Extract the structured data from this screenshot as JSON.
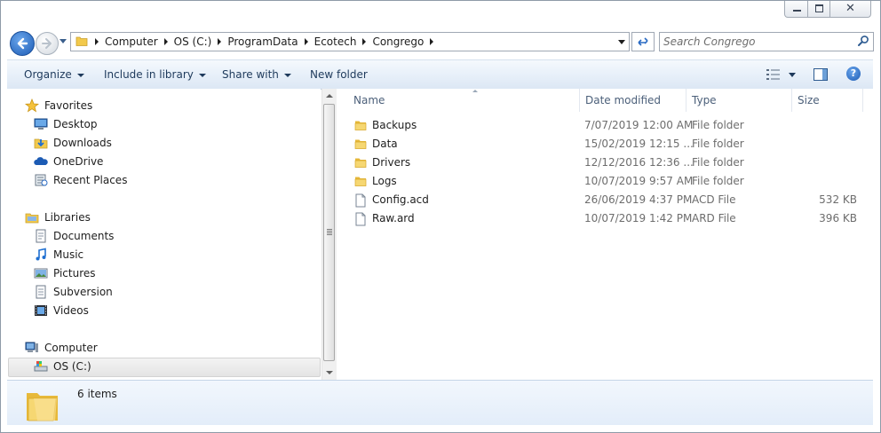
{
  "window": {
    "caption_buttons": {
      "minimize": "minimize",
      "maximize": "maximize",
      "close": "✕"
    }
  },
  "address_bar": {
    "crumbs": [
      "Computer",
      "OS (C:)",
      "ProgramData",
      "Ecotech",
      "Congrego"
    ]
  },
  "search": {
    "placeholder": "Search Congrego"
  },
  "toolbar": {
    "organize": "Organize",
    "include_in_library": "Include in library",
    "share_with": "Share with",
    "new_folder": "New folder",
    "help": "?"
  },
  "nav": {
    "favorites": {
      "label": "Favorites",
      "items": [
        {
          "label": "Desktop",
          "icon": "desktop-icon"
        },
        {
          "label": "Downloads",
          "icon": "downloads-icon"
        },
        {
          "label": "OneDrive",
          "icon": "onedrive-icon"
        },
        {
          "label": "Recent Places",
          "icon": "recent-places-icon"
        }
      ]
    },
    "libraries": {
      "label": "Libraries",
      "items": [
        {
          "label": "Documents",
          "icon": "documents-icon"
        },
        {
          "label": "Music",
          "icon": "music-icon"
        },
        {
          "label": "Pictures",
          "icon": "pictures-icon"
        },
        {
          "label": "Subversion",
          "icon": "subversion-icon"
        },
        {
          "label": "Videos",
          "icon": "videos-icon"
        }
      ]
    },
    "computer": {
      "label": "Computer",
      "items": [
        {
          "label": "OS (C:)",
          "icon": "drive-icon",
          "selected": true
        }
      ]
    }
  },
  "file_list": {
    "columns": [
      "Name",
      "Date modified",
      "Type",
      "Size"
    ],
    "rows": [
      {
        "name": "Backups",
        "date": "7/07/2019 12:00 AM",
        "type": "File folder",
        "size": "",
        "kind": "folder"
      },
      {
        "name": "Data",
        "date": "15/02/2019 12:15 ...",
        "type": "File folder",
        "size": "",
        "kind": "folder"
      },
      {
        "name": "Drivers",
        "date": "12/12/2016 12:36 ...",
        "type": "File folder",
        "size": "",
        "kind": "folder"
      },
      {
        "name": "Logs",
        "date": "10/07/2019 9:57 AM",
        "type": "File folder",
        "size": "",
        "kind": "folder"
      },
      {
        "name": "Config.acd",
        "date": "26/06/2019 4:37 PM",
        "type": "ACD File",
        "size": "532 KB",
        "kind": "file"
      },
      {
        "name": "Raw.ard",
        "date": "10/07/2019 1:42 PM",
        "type": "ARD File",
        "size": "396 KB",
        "kind": "file"
      }
    ]
  },
  "details": {
    "item_count": "6 items"
  },
  "colors": {
    "toolbar_text": "#1e3a5c",
    "header_text": "#4c607a",
    "folder_yellow": "#f2c94c",
    "accent_blue": "#1c5bb4"
  }
}
